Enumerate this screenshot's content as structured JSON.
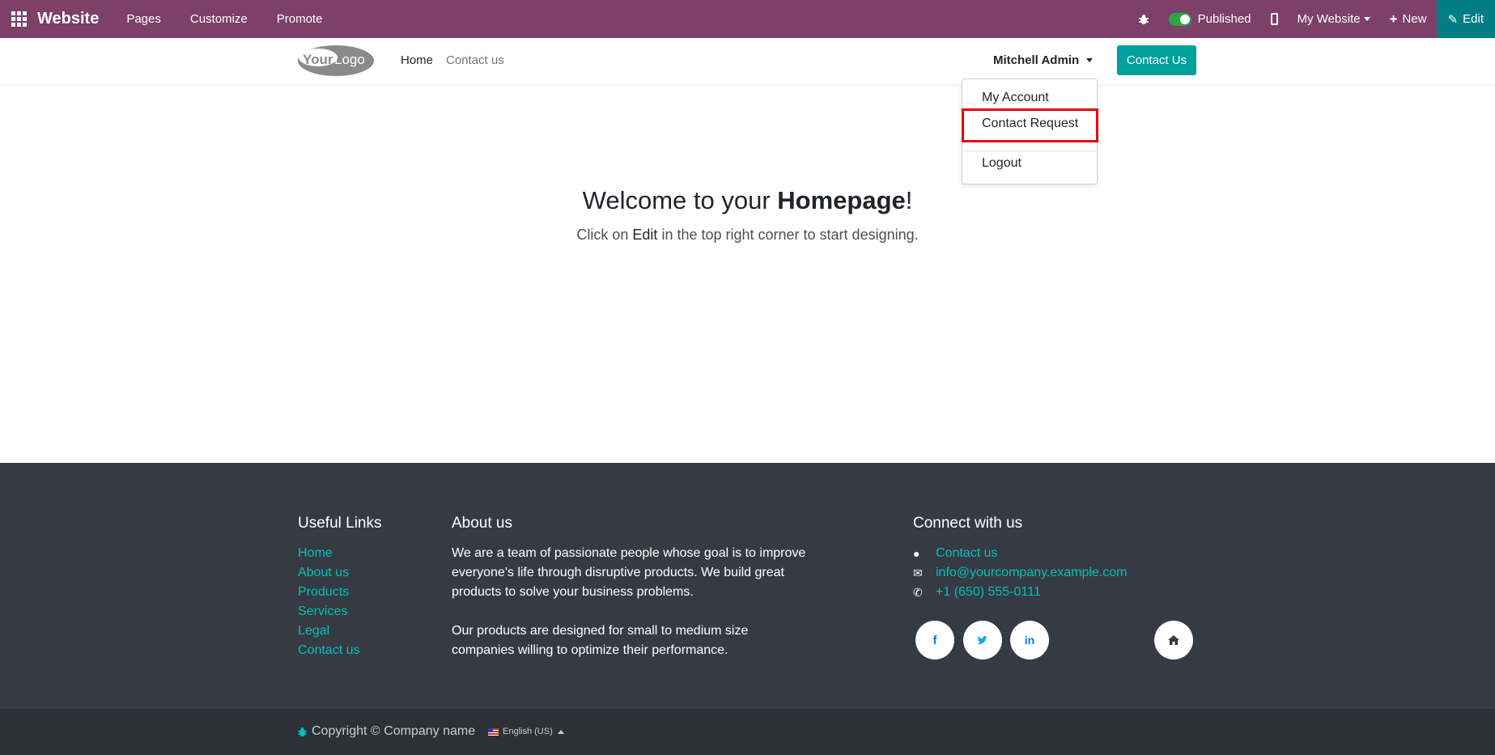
{
  "topbar": {
    "brand": "Website",
    "menu": [
      "Pages",
      "Customize",
      "Promote"
    ],
    "published_label": "Published",
    "website_selector": "My Website",
    "new_label": "New",
    "edit_label": "Edit"
  },
  "header": {
    "logo_text": "YourLogo",
    "nav": [
      "Home",
      "Contact us"
    ],
    "user": "Mitchell Admin",
    "cta": "Contact Us"
  },
  "dropdown": {
    "items": [
      "My Account",
      "Contact Request",
      "Logout"
    ],
    "highlighted": "Contact Request"
  },
  "main": {
    "welcome_prefix": "Welcome to your ",
    "welcome_bold": "Homepage",
    "welcome_suffix": "!",
    "sub_prefix": "Click on ",
    "sub_em": "Edit",
    "sub_suffix": " in the top right corner to start designing."
  },
  "footer": {
    "useful_links_title": "Useful Links",
    "useful_links": [
      "Home",
      "About us",
      "Products",
      "Services",
      "Legal",
      "Contact us"
    ],
    "about_title": "About us",
    "about_p1_lines": [
      "We are a team of passionate people whose goal is to improve",
      "everyone's life through disruptive products. We build great",
      "products to solve your business problems."
    ],
    "about_p2_lines": [
      "Our products are designed for small to medium size",
      "companies willing to optimize their performance."
    ],
    "connect_title": "Connect with us",
    "connect_contact": "Contact us",
    "connect_email": "info@yourcompany.example.com",
    "connect_phone": "+1 (650) 555-0111",
    "copyright": "Copyright © Company name",
    "language": "English (US)"
  },
  "colors": {
    "topbar": "#7c4069",
    "accent": "#00a09d",
    "footer": "#363a42",
    "highlight": "#e30613"
  }
}
